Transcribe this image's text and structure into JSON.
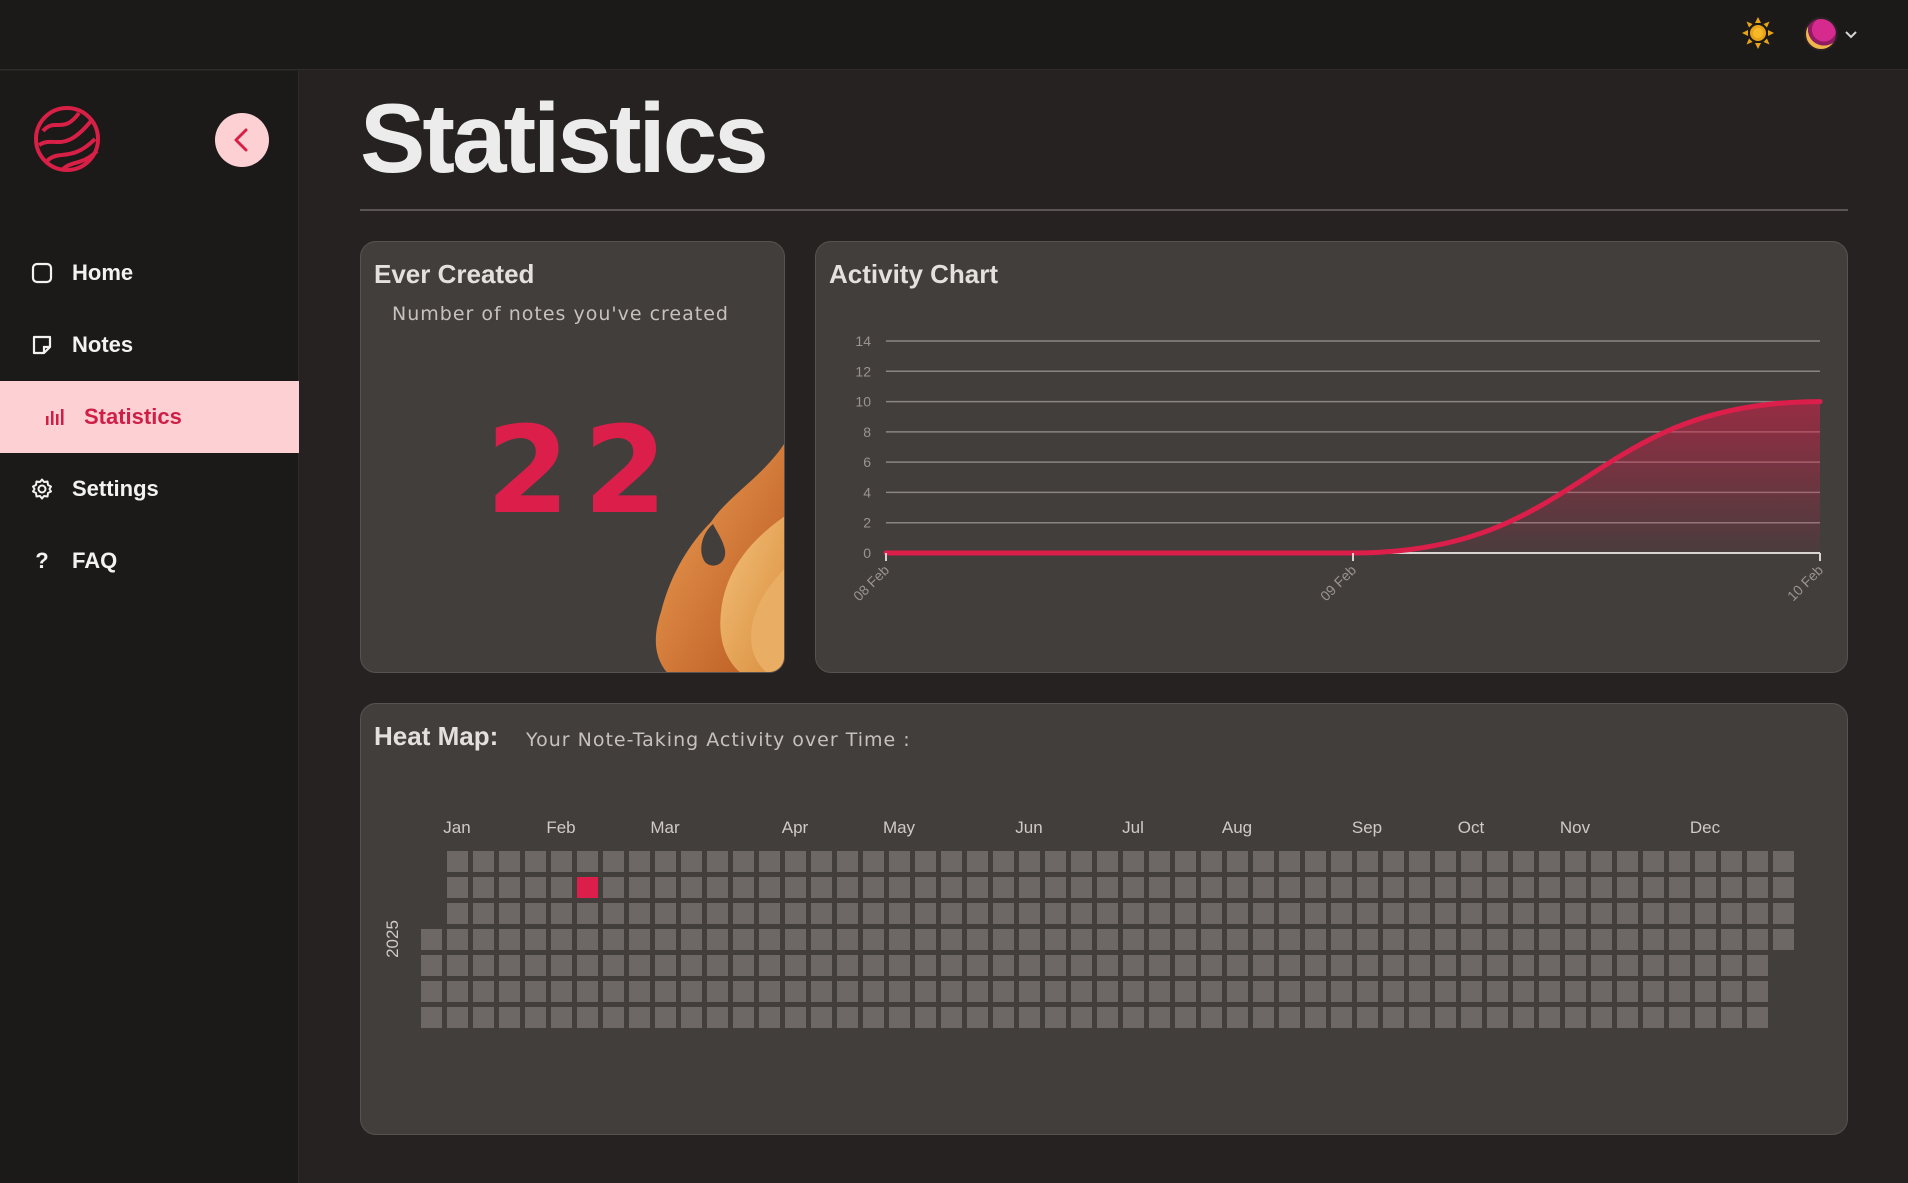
{
  "app": {
    "title": "Statistics",
    "theme_icon": "sun-icon",
    "user_avatar": "user-avatar"
  },
  "sidebar": {
    "collapse_icon": "chevron-left-icon",
    "items": [
      {
        "label": "Home",
        "icon": "square-icon",
        "active": false
      },
      {
        "label": "Notes",
        "icon": "note-icon",
        "active": false
      },
      {
        "label": "Statistics",
        "icon": "bar-chart-icon",
        "active": true
      },
      {
        "label": "Settings",
        "icon": "gear-icon",
        "active": false
      },
      {
        "label": "FAQ",
        "icon": "question-icon",
        "active": false
      }
    ]
  },
  "ever_created": {
    "title": "Ever Created",
    "subtitle": "Number of notes you've created",
    "count": "22"
  },
  "activity": {
    "title": "Activity Chart"
  },
  "heatmap": {
    "title": "Heat Map:",
    "subtitle": "Your Note-Taking Activity over Time :",
    "year_label": "2025",
    "months": [
      "Jan",
      "Feb",
      "Mar",
      "Apr",
      "May",
      "Jun",
      "Jul",
      "Aug",
      "Sep",
      "Oct",
      "Nov",
      "Dec"
    ],
    "active_day": "2025-02-10"
  },
  "colors": {
    "accent": "#dc1e4a",
    "accent_light": "#fdd1d4",
    "card": "#423e3c",
    "cell": "#6d6866"
  },
  "chart_data": {
    "type": "area",
    "x": [
      "08 Feb",
      "09 Feb",
      "10 Feb"
    ],
    "y": [
      0,
      0,
      10
    ],
    "ylim": [
      0,
      14
    ],
    "yticks": [
      0,
      2,
      4,
      6,
      8,
      10,
      12,
      14
    ],
    "grid": true,
    "title": "Activity Chart"
  }
}
